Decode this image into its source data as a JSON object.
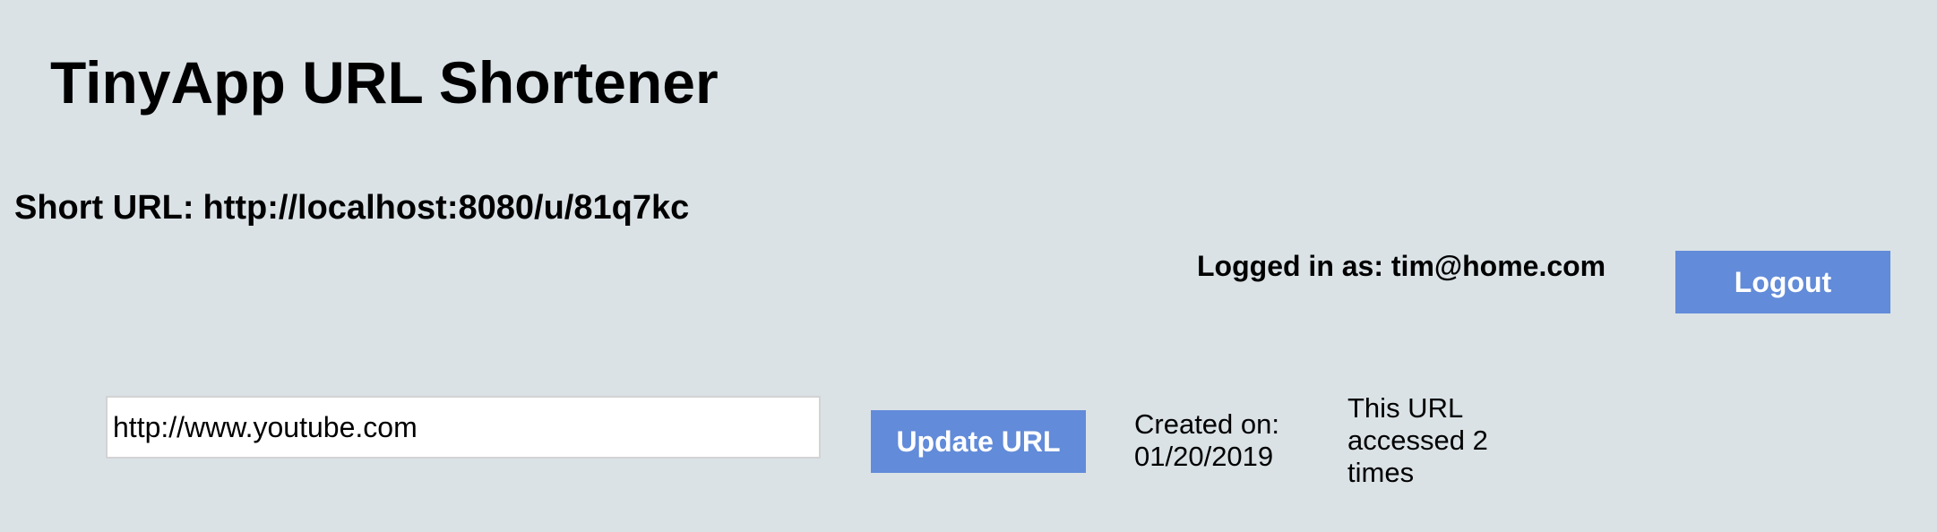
{
  "header": {
    "title": "TinyApp URL Shortener"
  },
  "short_url": {
    "label": "Short URL:",
    "value": "http://localhost:8080/u/81q7kc"
  },
  "user": {
    "logged_in_text": "Logged in as: tim@home.com",
    "logout_label": "Logout"
  },
  "edit_form": {
    "long_url_value": "http://www.youtube.com",
    "update_label": "Update URL"
  },
  "stats": {
    "created_label": "Created on:",
    "created_date": "01/20/2019",
    "accessed_line1": "This URL",
    "accessed_line2": "accessed 2",
    "accessed_line3": "times"
  },
  "colors": {
    "background": "#dae2e6",
    "button": "#628bd9",
    "button_text": "#ffffff"
  }
}
